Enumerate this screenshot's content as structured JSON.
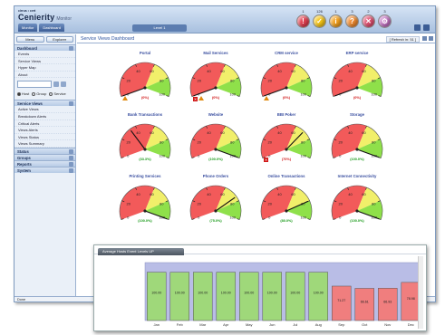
{
  "brand": {
    "small": "cirrus • cert",
    "name": "Cenierity",
    "product": "Monitor"
  },
  "nav": {
    "tabs": [
      "Monitor",
      "Dashboard"
    ],
    "user": "Level 1"
  },
  "status_indicators": [
    {
      "count": "1",
      "color": "#e04050",
      "glyph": "!"
    },
    {
      "count": "126",
      "color": "#f5c518",
      "glyph": "✓"
    },
    {
      "count": "1",
      "color": "#f2a020",
      "glyph": "i"
    },
    {
      "count": "3",
      "color": "#ee8a30",
      "glyph": "?"
    },
    {
      "count": "2",
      "color": "#e05070",
      "glyph": "✕"
    },
    {
      "count": "3",
      "color": "#c070c0",
      "glyph": "⚙"
    }
  ],
  "sidebar": {
    "buttons": [
      "Menu",
      "Explorer"
    ],
    "section1": {
      "label": "Dashboard",
      "items": [
        "Events",
        "Service Views",
        "Hyper Map",
        "About"
      ]
    },
    "radio_options": [
      "Host",
      "Group",
      "Service"
    ],
    "section2": {
      "label": "Service Views",
      "items": [
        "Active Views",
        "Breakdown Alerts",
        "Critical Alerts",
        "Views Alerts",
        "Views Status",
        "Views Summary"
      ]
    },
    "collapsed_sections": [
      "Status",
      "Groups",
      "Reports",
      "System"
    ]
  },
  "main": {
    "title": "Service Views Dashboard",
    "refresh_label": "[ Refresh in: 51 ]"
  },
  "gauges": [
    {
      "name": "Portal",
      "value": 0,
      "value_text": "(0%)",
      "status": "red",
      "alerts": "⚠"
    },
    {
      "name": "Mail Services",
      "value": 0,
      "value_text": "(0%)",
      "status": "red",
      "alerts": "✕⚠"
    },
    {
      "name": "CRM service",
      "value": 0,
      "value_text": "(0%)",
      "status": "red",
      "alerts": "⚠"
    },
    {
      "name": "ERP service",
      "value": 0,
      "value_text": "(0%)",
      "status": "red",
      "alerts": ""
    },
    {
      "name": "Bank Transactions",
      "value": 33.3,
      "value_text": "(33.3%)",
      "status": "green",
      "alerts": ""
    },
    {
      "name": "Website",
      "value": 100,
      "value_text": "(100.0%)",
      "status": "green",
      "alerts": ""
    },
    {
      "name": "BBI Poker",
      "value": 70,
      "value_text": "(70%)",
      "status": "red",
      "alerts": "✕"
    },
    {
      "name": "Storage",
      "value": 100,
      "value_text": "(100.0%)",
      "status": "green",
      "alerts": ""
    },
    {
      "name": "Printing Services",
      "value": 100,
      "value_text": "(100.0%)",
      "status": "green",
      "alerts": ""
    },
    {
      "name": "Phone Orders",
      "value": 75,
      "value_text": "(75.0%)",
      "status": "green",
      "alerts": ""
    },
    {
      "name": "Online Transactions",
      "value": 80,
      "value_text": "(80.0%)",
      "status": "green",
      "alerts": ""
    },
    {
      "name": "Internet Connectivity",
      "value": 100,
      "value_text": "(100.0%)",
      "status": "green",
      "alerts": ""
    }
  ],
  "statusbar": {
    "text": "Done"
  },
  "chart_data": {
    "type": "bar",
    "title": "Average Hosts Event Levels UP",
    "categories": [
      "Jan",
      "Feb",
      "Mar",
      "Apr",
      "May",
      "Jun",
      "Jul",
      "Aug",
      "Sep",
      "Oct",
      "Nov",
      "Dec"
    ],
    "values": [
      100,
      100,
      100,
      100,
      100,
      100,
      100,
      100,
      71.27,
      66.61,
      66.93,
      78.98
    ],
    "value_labels": [
      "100.00",
      "100.00",
      "100.00",
      "100.00",
      "100.00",
      "100.00",
      "100.00",
      "100.00",
      "71.27",
      "66.61",
      "66.93",
      "78.98"
    ],
    "ylim": [
      0,
      120
    ],
    "colors": {
      "up": "#9fd87a",
      "down": "#f07e7e",
      "background": "#b9bde6"
    }
  }
}
